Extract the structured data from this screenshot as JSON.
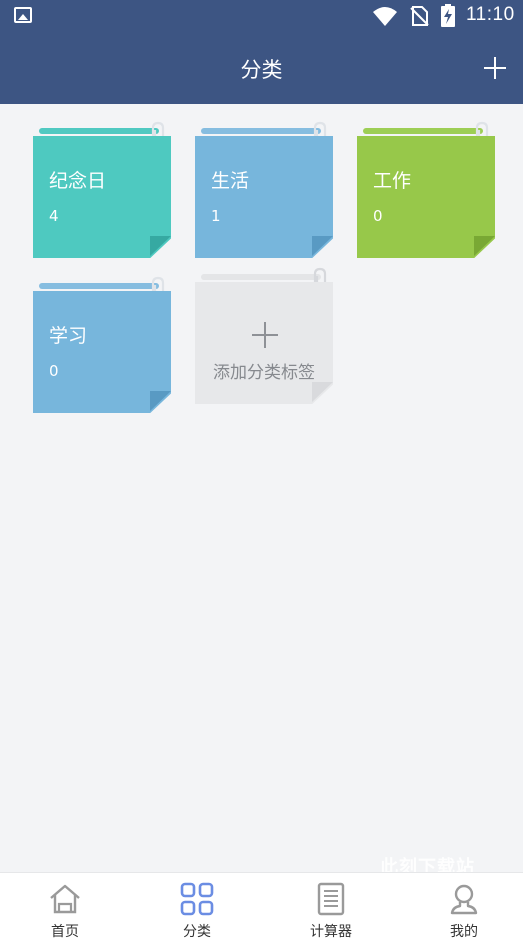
{
  "status_bar": {
    "time": "11:10",
    "icons": [
      "image-icon",
      "wifi-icon",
      "no-sim-icon",
      "battery-charging-icon"
    ]
  },
  "header": {
    "title": "分类",
    "add_icon": "plus-icon"
  },
  "categories": [
    {
      "name": "纪念日",
      "count": "4",
      "color": "#4ec9c0"
    },
    {
      "name": "生活",
      "count": "1",
      "color": "#77b6dc"
    },
    {
      "name": "工作",
      "count": "0",
      "color": "#97c84a"
    },
    {
      "name": "学习",
      "count": "0",
      "color": "#77b6dc"
    }
  ],
  "add_category": {
    "label": "添加分类标签",
    "icon": "plus-icon"
  },
  "bottom_nav": {
    "items": [
      {
        "label": "首页",
        "icon": "home-icon",
        "active": false
      },
      {
        "label": "分类",
        "icon": "grid-icon",
        "active": true
      },
      {
        "label": "计算器",
        "icon": "document-icon",
        "active": false
      },
      {
        "label": "我的",
        "icon": "person-icon",
        "active": false
      }
    ],
    "active_color": "#6b8de3",
    "inactive_color": "#9a9a9a"
  },
  "watermark": "此刻下载站"
}
